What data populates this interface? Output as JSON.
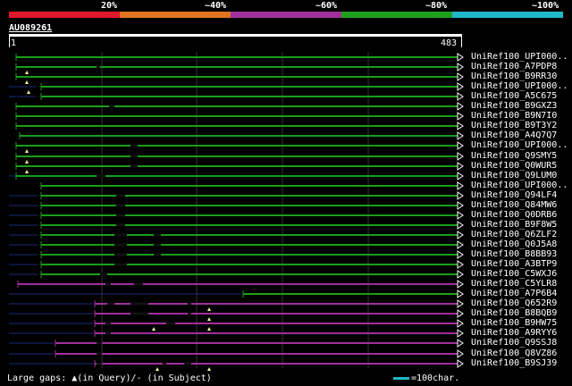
{
  "scale": {
    "labels": [
      "20%",
      "~40%",
      "~60%",
      "~80%",
      "~100%"
    ],
    "colors": [
      "#e0182e",
      "#e07420",
      "#a0309c",
      "#1ea01e",
      "#20b8c8"
    ]
  },
  "query": {
    "id": "AU089261",
    "start": "1",
    "end": "483"
  },
  "colors": {
    "green": "#1a9e1a",
    "magenta": "#a0309c",
    "navy": "#1a2a7a",
    "arrow": "#ffffff",
    "gap_marker": "#f6f6a0"
  },
  "hits": [
    {
      "label": "UniRef100_UPI000..",
      "color": "green"
    },
    {
      "label": "UniRef100_A7PDP8",
      "color": "green"
    },
    {
      "label": "UniRef100_B9RR30",
      "color": "green"
    },
    {
      "label": "UniRef100_UPI000..",
      "color": "green"
    },
    {
      "label": "UniRef100_A5C675",
      "color": "green"
    },
    {
      "label": "UniRef100_B9GXZ3",
      "color": "green"
    },
    {
      "label": "UniRef100_B9N7I0",
      "color": "green"
    },
    {
      "label": "UniRef100_B9T3Y2",
      "color": "green"
    },
    {
      "label": "UniRef100_A4Q7Q7",
      "color": "green"
    },
    {
      "label": "UniRef100_UPI000..",
      "color": "green"
    },
    {
      "label": "UniRef100_Q9SMY5",
      "color": "green"
    },
    {
      "label": "UniRef100_Q0WUR5",
      "color": "green"
    },
    {
      "label": "UniRef100_Q9LUM0",
      "color": "green"
    },
    {
      "label": "UniRef100_UPI000..",
      "color": "green"
    },
    {
      "label": "UniRef100_Q94LF4",
      "color": "green"
    },
    {
      "label": "UniRef100_Q84MW6",
      "color": "green"
    },
    {
      "label": "UniRef100_Q0DRB6",
      "color": "green"
    },
    {
      "label": "UniRef100_B9F8W5",
      "color": "green"
    },
    {
      "label": "UniRef100_Q6ZLF2",
      "color": "green"
    },
    {
      "label": "UniRef100_Q0J5A8",
      "color": "green"
    },
    {
      "label": "UniRef100_B8BB93",
      "color": "green"
    },
    {
      "label": "UniRef100_A3BTP9",
      "color": "green"
    },
    {
      "label": "UniRef100_C5WXJ6",
      "color": "green"
    },
    {
      "label": "UniRef100_C5YLR8",
      "color": "magenta"
    },
    {
      "label": "UniRef100_A7P6B4",
      "color": "green"
    },
    {
      "label": "UniRef100_Q652R9",
      "color": "magenta"
    },
    {
      "label": "UniRef100_B8BQB9",
      "color": "magenta"
    },
    {
      "label": "UniRef100_B9HW75",
      "color": "magenta"
    },
    {
      "label": "UniRef100_A9RYY6",
      "color": "magenta"
    },
    {
      "label": "UniRef100_Q9SSJ8",
      "color": "magenta"
    },
    {
      "label": "UniRef100_Q8VZ86",
      "color": "magenta"
    },
    {
      "label": "UniRef100_B9SJ39",
      "color": "magenta"
    }
  ],
  "footer": {
    "gaps_text": "Large gaps: ▲(in Query)/- (in Subject)",
    "legend_text": "=100char."
  }
}
